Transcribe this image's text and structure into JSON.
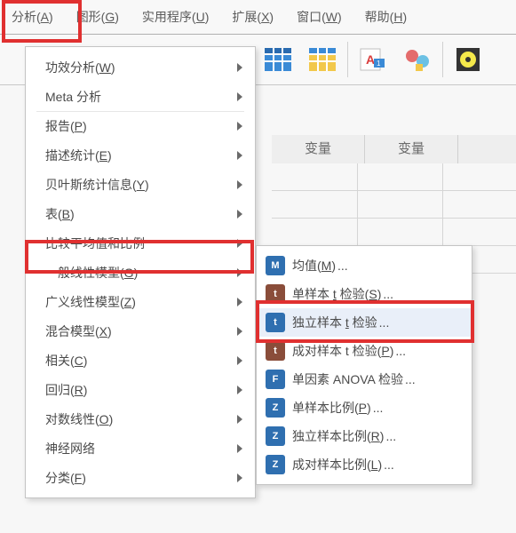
{
  "menubar": {
    "analyze": {
      "pre": "分析(",
      "u": "A",
      "post": ")"
    },
    "graphs": {
      "pre": "图形(",
      "u": "G",
      "post": ")"
    },
    "utilities": {
      "pre": "实用程序(",
      "u": "U",
      "post": ")"
    },
    "extensions": {
      "pre": "扩展(",
      "u": "X",
      "post": ")"
    },
    "window": {
      "pre": "窗口(",
      "u": "W",
      "post": ")"
    },
    "help": {
      "pre": "帮助(",
      "u": "H",
      "post": ")"
    }
  },
  "menu": [
    {
      "pre": "功效分析(",
      "u": "W",
      "post": ")",
      "arrow": true
    },
    {
      "pre": "Meta 分析",
      "u": "",
      "post": "",
      "arrow": true,
      "div": true
    },
    {
      "pre": "报告(",
      "u": "P",
      "post": ")",
      "arrow": true
    },
    {
      "pre": "描述统计(",
      "u": "E",
      "post": ")",
      "arrow": true
    },
    {
      "pre": "贝叶斯统计信息(",
      "u": "Y",
      "post": ")",
      "arrow": true
    },
    {
      "pre": "表(",
      "u": "B",
      "post": ")",
      "arrow": true
    },
    {
      "pre": "比较平均值和比例",
      "u": "",
      "post": "",
      "arrow": true,
      "hl": true
    },
    {
      "pre": "一般线性模型(",
      "u": "G",
      "post": ")",
      "arrow": true
    },
    {
      "pre": "广义线性模型(",
      "u": "Z",
      "post": ")",
      "arrow": true
    },
    {
      "pre": "混合模型(",
      "u": "X",
      "post": ")",
      "arrow": true
    },
    {
      "pre": "相关(",
      "u": "C",
      "post": ")",
      "arrow": true
    },
    {
      "pre": "回归(",
      "u": "R",
      "post": ")",
      "arrow": true
    },
    {
      "pre": "对数线性(",
      "u": "O",
      "post": ")",
      "arrow": true
    },
    {
      "pre": "神经网络",
      "u": "",
      "post": "",
      "arrow": true
    },
    {
      "pre": "分类(",
      "u": "F",
      "post": ")",
      "arrow": true
    }
  ],
  "submenu": [
    {
      "icon": "M",
      "bg": "#2f6fb0",
      "pre": "均值(",
      "u": "M",
      "post": ")",
      "dots": true
    },
    {
      "icon": "t",
      "bg": "#8a4d3a",
      "pre": "单样本 ",
      "u": "t",
      "post": " 检验(",
      "u2": "S",
      "post2": ")",
      "dots": true
    },
    {
      "icon": "t",
      "bg": "#2f6fb0",
      "pre": "独立样本 ",
      "u": "t",
      "post": " 检验",
      "dots": true,
      "hl": true
    },
    {
      "icon": "t",
      "bg": "#8a4d3a",
      "pre": "成对样本 t 检验(",
      "u": "P",
      "post": ")",
      "dots": true
    },
    {
      "icon": "F",
      "bg": "#2f6fb0",
      "pre": "单因素 ANOVA 检验",
      "u": "",
      "post": "",
      "dots": true
    },
    {
      "icon": "Z",
      "bg": "#2f6fb0",
      "pre": "单样本比例(",
      "u": "P",
      "post": ")",
      "dots": true
    },
    {
      "icon": "Z",
      "bg": "#2f6fb0",
      "pre": "独立样本比例(",
      "u": "R",
      "post": ")",
      "dots": true
    },
    {
      "icon": "Z",
      "bg": "#2f6fb0",
      "pre": "成对样本比例(",
      "u": "L",
      "post": ")",
      "dots": true
    }
  ],
  "columns": {
    "c1": "变量",
    "c2": "变量"
  }
}
